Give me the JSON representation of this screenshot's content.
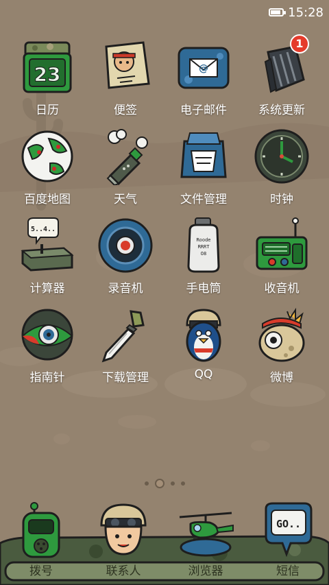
{
  "status_bar": {
    "time": "15:28",
    "battery_level": 0.85
  },
  "apps": [
    {
      "label": "日历",
      "icon": "calendar-icon",
      "calendar_day": "23"
    },
    {
      "label": "便签",
      "icon": "notepad-icon"
    },
    {
      "label": "电子邮件",
      "icon": "email-icon"
    },
    {
      "label": "系统更新",
      "icon": "system-update-icon",
      "badge": "1"
    },
    {
      "label": "百度地图",
      "icon": "globe-map-icon"
    },
    {
      "label": "天气",
      "icon": "grenade-weather-icon"
    },
    {
      "label": "文件管理",
      "icon": "backpack-files-icon"
    },
    {
      "label": "时钟",
      "icon": "clock-icon"
    },
    {
      "label": "计算器",
      "icon": "detonator-calculator-icon",
      "bubble_text": "5..4.."
    },
    {
      "label": "录音机",
      "icon": "recorder-icon"
    },
    {
      "label": "手电筒",
      "icon": "flashlight-grenade-icon",
      "can_text": "Roode\nRRRT\nO8"
    },
    {
      "label": "收音机",
      "icon": "radio-icon"
    },
    {
      "label": "指南针",
      "icon": "compass-eye-icon"
    },
    {
      "label": "下载管理",
      "icon": "knife-download-icon"
    },
    {
      "label": "QQ",
      "icon": "qq-penguin-icon"
    },
    {
      "label": "微博",
      "icon": "weibo-eye-icon"
    }
  ],
  "page_indicator": {
    "pages": 4,
    "active": 1
  },
  "dock": [
    {
      "label": "拨号",
      "icon": "walkie-talkie-phone-icon"
    },
    {
      "label": "联系人",
      "icon": "soldier-contacts-icon"
    },
    {
      "label": "浏览器",
      "icon": "helicopter-browser-icon"
    },
    {
      "label": "短信",
      "icon": "speech-bubble-sms-icon",
      "bubble_text": "GO.."
    }
  ],
  "colors": {
    "background": "#94836f",
    "label_text": "#ffffff",
    "dock_label": "#2d3320",
    "badge": "#e53b2b",
    "army_green": "#2e8b3a"
  }
}
